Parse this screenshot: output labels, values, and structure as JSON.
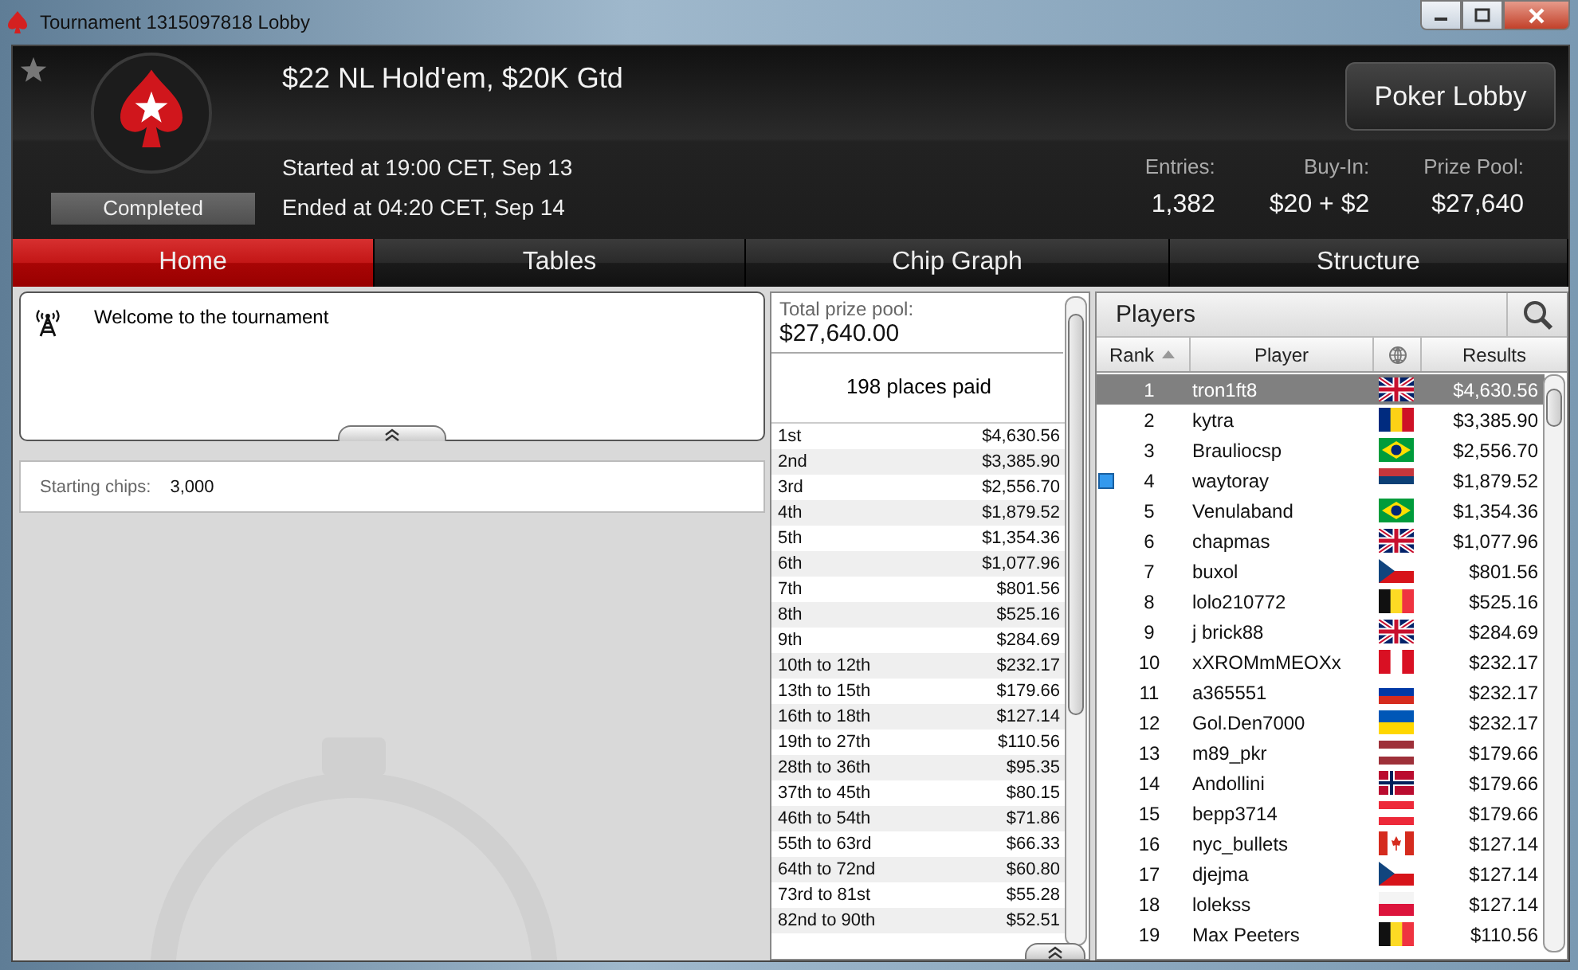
{
  "window": {
    "title": "Tournament 1315097818 Lobby"
  },
  "header": {
    "title": "$22 NL Hold'em, $20K Gtd",
    "started": "Started at 19:00 CET, Sep 13",
    "ended": "Ended at 04:20 CET, Sep 14",
    "status": "Completed",
    "lobby_button": "Poker Lobby",
    "stats": [
      {
        "label": "Entries:",
        "value": "1,382"
      },
      {
        "label": "Buy-In:",
        "value": "$20 + $2"
      },
      {
        "label": "Prize Pool:",
        "value": "$27,640"
      }
    ]
  },
  "tabs": [
    {
      "label": "Home",
      "selected": true
    },
    {
      "label": "Tables",
      "selected": false
    },
    {
      "label": "Chip Graph",
      "selected": false
    },
    {
      "label": "Structure",
      "selected": false
    }
  ],
  "news": {
    "message": "Welcome to the tournament"
  },
  "starting_chips": {
    "label": "Starting chips:",
    "value": "3,000"
  },
  "prize_pool": {
    "label": "Total prize pool:",
    "value": "$27,640.00",
    "places_paid": "198 places paid",
    "payouts": [
      {
        "place": "1st",
        "amount": "$4,630.56"
      },
      {
        "place": "2nd",
        "amount": "$3,385.90"
      },
      {
        "place": "3rd",
        "amount": "$2,556.70"
      },
      {
        "place": "4th",
        "amount": "$1,879.52"
      },
      {
        "place": "5th",
        "amount": "$1,354.36"
      },
      {
        "place": "6th",
        "amount": "$1,077.96"
      },
      {
        "place": "7th",
        "amount": "$801.56"
      },
      {
        "place": "8th",
        "amount": "$525.16"
      },
      {
        "place": "9th",
        "amount": "$284.69"
      },
      {
        "place": "10th to 12th",
        "amount": "$232.17"
      },
      {
        "place": "13th to 15th",
        "amount": "$179.66"
      },
      {
        "place": "16th to 18th",
        "amount": "$127.14"
      },
      {
        "place": "19th to 27th",
        "amount": "$110.56"
      },
      {
        "place": "28th to 36th",
        "amount": "$95.35"
      },
      {
        "place": "37th to 45th",
        "amount": "$80.15"
      },
      {
        "place": "46th to 54th",
        "amount": "$71.86"
      },
      {
        "place": "55th to 63rd",
        "amount": "$66.33"
      },
      {
        "place": "64th to 72nd",
        "amount": "$60.80"
      },
      {
        "place": "73rd to 81st",
        "amount": "$55.28"
      },
      {
        "place": "82nd to 90th",
        "amount": "$52.51"
      }
    ]
  },
  "players": {
    "title": "Players",
    "columns": [
      {
        "kind": "text",
        "label": "Rank",
        "sorted": true
      },
      {
        "kind": "text",
        "label": "Player",
        "sorted": false
      },
      {
        "kind": "globe",
        "sorted": false
      },
      {
        "kind": "text",
        "label": "Results",
        "sorted": false
      }
    ],
    "rows": [
      {
        "rank": "1",
        "name": "tron1ft8",
        "kind": "gb",
        "result": "$4,630.56",
        "selected": true,
        "marked": false
      },
      {
        "rank": "2",
        "name": "kytra",
        "kind": "ro",
        "result": "$3,385.90",
        "selected": false,
        "marked": false
      },
      {
        "rank": "3",
        "name": "Brauliocsp",
        "kind": "br",
        "result": "$2,556.70",
        "selected": false,
        "marked": false
      },
      {
        "rank": "4",
        "name": "waytoray",
        "kind": "rs",
        "result": "$1,879.52",
        "selected": false,
        "marked": true
      },
      {
        "rank": "5",
        "name": "Venulaband",
        "kind": "br",
        "result": "$1,354.36",
        "selected": false,
        "marked": false
      },
      {
        "rank": "6",
        "name": "chapmas",
        "kind": "gb",
        "result": "$1,077.96",
        "selected": false,
        "marked": false
      },
      {
        "rank": "7",
        "name": "buxol",
        "kind": "cz",
        "result": "$801.56",
        "selected": false,
        "marked": false
      },
      {
        "rank": "8",
        "name": "lolo210772",
        "kind": "be",
        "result": "$525.16",
        "selected": false,
        "marked": false
      },
      {
        "rank": "9",
        "name": "j brick88",
        "kind": "gb",
        "result": "$284.69",
        "selected": false,
        "marked": false
      },
      {
        "rank": "10",
        "name": "xXROMmMEOXx",
        "kind": "pe",
        "result": "$232.17",
        "selected": false,
        "marked": false
      },
      {
        "rank": "11",
        "name": "a365551",
        "kind": "ru",
        "result": "$232.17",
        "selected": false,
        "marked": false
      },
      {
        "rank": "12",
        "name": "Gol.Den7000",
        "kind": "ua",
        "result": "$232.17",
        "selected": false,
        "marked": false
      },
      {
        "rank": "13",
        "name": "m89_pkr",
        "kind": "lv",
        "result": "$179.66",
        "selected": false,
        "marked": false
      },
      {
        "rank": "14",
        "name": "Andollini",
        "kind": "no",
        "result": "$179.66",
        "selected": false,
        "marked": false
      },
      {
        "rank": "15",
        "name": "bepp3714",
        "kind": "at",
        "result": "$179.66",
        "selected": false,
        "marked": false
      },
      {
        "rank": "16",
        "name": "nyc_bullets",
        "kind": "ca",
        "result": "$127.14",
        "selected": false,
        "marked": false
      },
      {
        "rank": "17",
        "name": "djejma",
        "kind": "cz",
        "result": "$127.14",
        "selected": false,
        "marked": false
      },
      {
        "rank": "18",
        "name": "lolekss",
        "kind": "pl",
        "result": "$127.14",
        "selected": false,
        "marked": false
      },
      {
        "rank": "19",
        "name": "Max Peeters",
        "kind": "be",
        "result": "$110.56",
        "selected": false,
        "marked": false
      }
    ]
  }
}
